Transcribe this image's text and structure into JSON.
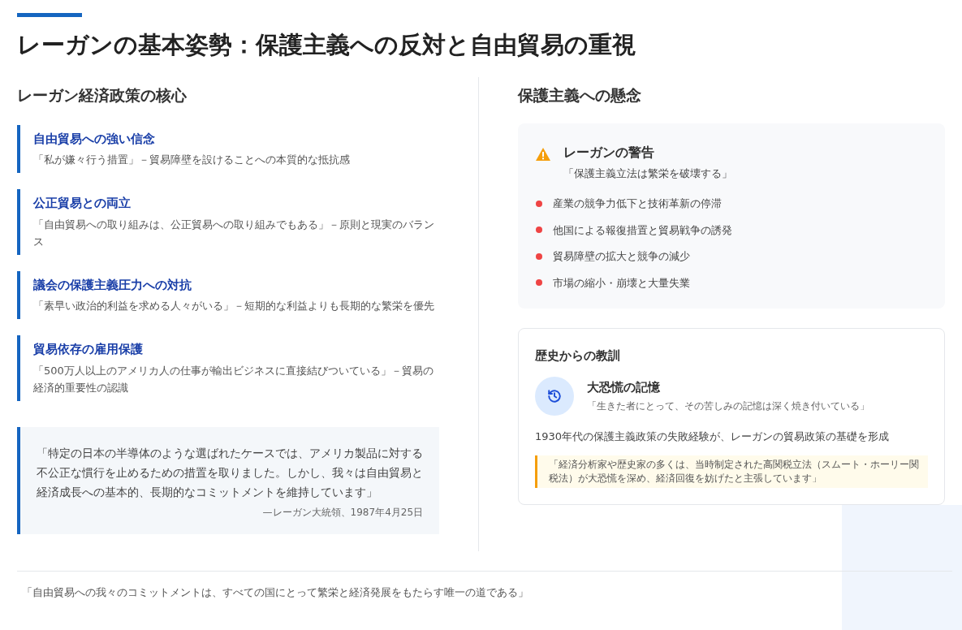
{
  "title": "レーガンの基本姿勢：保護主義への反対と自由貿易の重視",
  "left": {
    "heading": "レーガン経済政策の核心",
    "points": [
      {
        "title": "自由貿易への強い信念",
        "text": "「私が嫌々行う措置」－貿易障壁を設けることへの本質的な抵抗感"
      },
      {
        "title": "公正貿易との両立",
        "text": "「自由貿易への取り組みは、公正貿易への取り組みでもある」－原則と現実のバランス"
      },
      {
        "title": "議会の保護主義圧力への対抗",
        "text": "「素早い政治的利益を求める人々がいる」－短期的な利益よりも長期的な繁栄を優先"
      },
      {
        "title": "貿易依存の雇用保護",
        "text": "「500万人以上のアメリカ人の仕事が輸出ビジネスに直接結びついている」－貿易の経済的重要性の認識"
      }
    ],
    "quote": {
      "text": "「特定の日本の半導体のような選ばれたケースでは、アメリカ製品に対する不公正な慣行を止めるための措置を取りました。しかし、我々は自由貿易と経済成長への基本的、長期的なコミットメントを維持しています」",
      "attribution": "—レーガン大統領、1987年4月25日"
    }
  },
  "right": {
    "heading": "保護主義への懸念",
    "warning": {
      "title": "レーガンの警告",
      "quote": "「保護主義立法は繁栄を破壊する」",
      "items": [
        "産業の競争力低下と技術革新の停滞",
        "他国による報復措置と貿易戦争の誘発",
        "貿易障壁の拡大と競争の減少",
        "市場の縮小・崩壊と大量失業"
      ]
    },
    "lesson": {
      "heading": "歴史からの教訓",
      "title": "大恐慌の記憶",
      "subtitle": "「生きた者にとって、その苦しみの記憶は深く焼き付いている」",
      "text": "1930年代の保護主義政策の失敗経験が、レーガンの貿易政策の基礎を形成",
      "note": "「経済分析家や歴史家の多くは、当時制定された高関税立法（スムート・ホーリー関税法）が大恐慌を深め、経済回復を妨げたと主張しています」"
    }
  },
  "footer": "「自由貿易への我々のコミットメントは、すべての国にとって繁栄と経済発展をもたらす唯一の道である」"
}
